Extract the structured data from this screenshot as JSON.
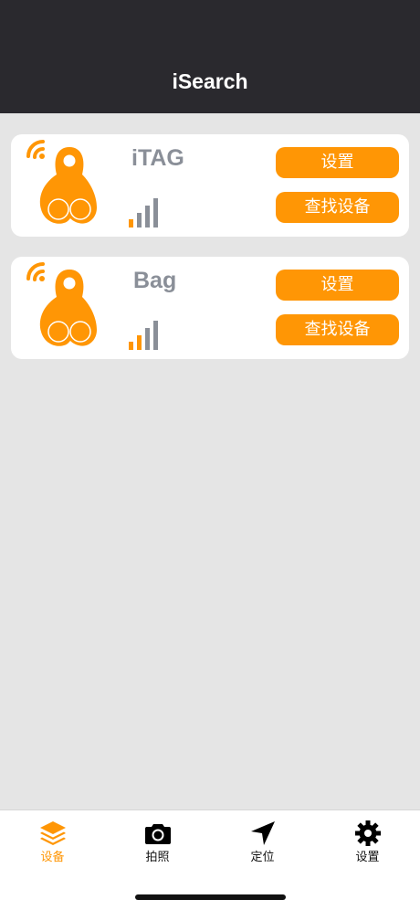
{
  "header": {
    "title": "iSearch"
  },
  "devices": [
    {
      "name": "iTAG",
      "icon": "key-tag-icon",
      "signal_icon": "signal-strength-icon",
      "settings_label": "设置",
      "find_label": "查找设备"
    },
    {
      "name": "Bag",
      "icon": "key-tag-icon",
      "signal_icon": "signal-strength-icon",
      "settings_label": "设置",
      "find_label": "查找设备"
    }
  ],
  "tabbar": {
    "active_index": 0,
    "items": [
      {
        "label": "设备",
        "icon": "layers-icon"
      },
      {
        "label": "拍照",
        "icon": "camera-icon"
      },
      {
        "label": "定位",
        "icon": "location-arrow-icon"
      },
      {
        "label": "设置",
        "icon": "gear-icon"
      }
    ]
  },
  "colors": {
    "accent": "#ff9605",
    "header_bg": "#2a292e",
    "page_bg": "#e5e5e5",
    "device_name": "#8a8f98",
    "signal_gray": "#8a8f98"
  }
}
